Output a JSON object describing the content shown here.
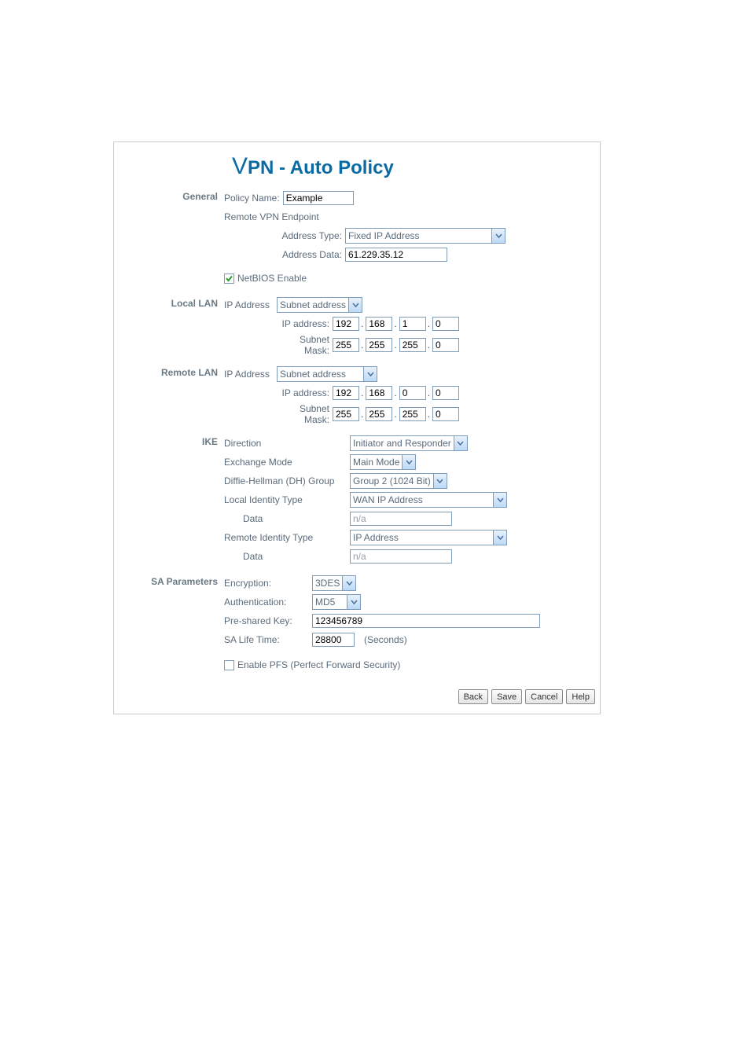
{
  "title_prefix": "V",
  "title_rest": "PN - Auto Policy",
  "sections": {
    "general": "General",
    "local_lan": "Local LAN",
    "remote_lan": "Remote LAN",
    "ike": "IKE",
    "sa_params": "SA Parameters"
  },
  "general": {
    "policy_name_label": "Policy Name:",
    "policy_name_value": "Example",
    "remote_vpn_endpoint_label": "Remote VPN Endpoint",
    "address_type_label": "Address Type:",
    "address_type_value": "Fixed IP Address",
    "address_data_label": "Address Data:",
    "address_data_value": "61.229.35.12",
    "netbios_enable_label": "NetBIOS Enable",
    "netbios_enable_checked": true
  },
  "local_lan": {
    "ip_address_label": "IP Address",
    "subnet_address_select": "Subnet address",
    "ip_address_sub_label": "IP address:",
    "subnet_mask_label": "Subnet Mask:",
    "ip": [
      "192",
      "168",
      "1",
      "0"
    ],
    "mask": [
      "255",
      "255",
      "255",
      "0"
    ]
  },
  "remote_lan": {
    "ip_address_label": "IP Address",
    "subnet_address_select": "Subnet address",
    "ip_address_sub_label": "IP address:",
    "subnet_mask_label": "Subnet Mask:",
    "ip": [
      "192",
      "168",
      "0",
      "0"
    ],
    "mask": [
      "255",
      "255",
      "255",
      "0"
    ]
  },
  "ike": {
    "direction_label": "Direction",
    "direction_value": "Initiator and Responder",
    "exchange_mode_label": "Exchange Mode",
    "exchange_mode_value": "Main Mode",
    "dh_group_label": "Diffie-Hellman (DH) Group",
    "dh_group_value": "Group 2 (1024 Bit)",
    "local_identity_type_label": "Local Identity Type",
    "local_identity_type_value": "WAN IP Address",
    "data_label": "Data",
    "local_data_value": "n/a",
    "remote_identity_type_label": "Remote Identity Type",
    "remote_identity_type_value": "IP Address",
    "remote_data_value": "n/a"
  },
  "sa": {
    "encryption_label": "Encryption:",
    "encryption_value": "3DES",
    "authentication_label": "Authentication:",
    "authentication_value": "MD5",
    "preshared_key_label": "Pre-shared Key:",
    "preshared_key_value": "123456789",
    "sa_life_time_label": "SA Life Time:",
    "sa_life_time_value": "28800",
    "seconds_label": "(Seconds)",
    "enable_pfs_label": "Enable PFS (Perfect Forward Security)",
    "enable_pfs_checked": false
  },
  "buttons": {
    "back": "Back",
    "save": "Save",
    "cancel": "Cancel",
    "help": "Help"
  }
}
